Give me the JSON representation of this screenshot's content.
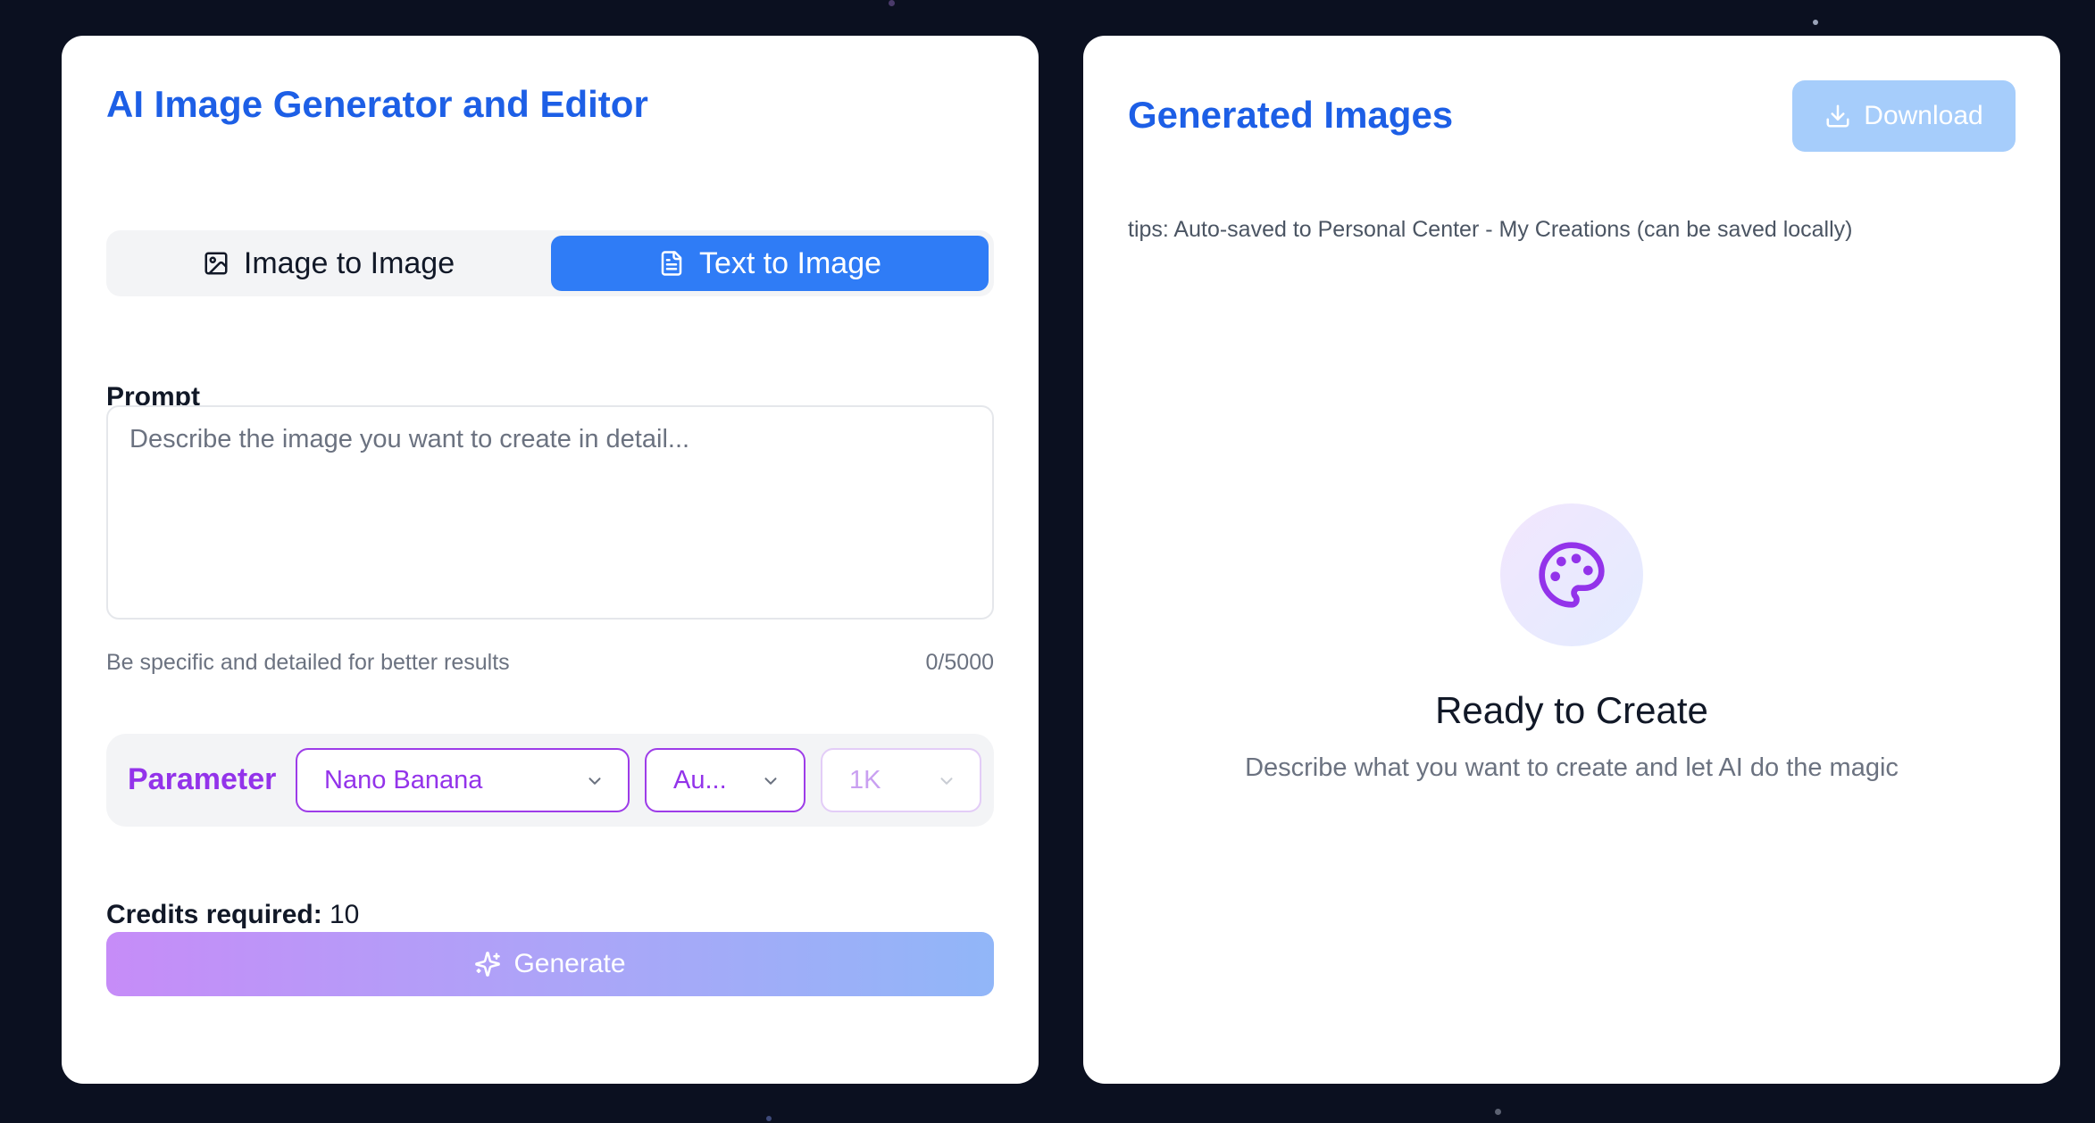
{
  "colors": {
    "background": "#0b1020",
    "accent_blue": "#1d5fe6",
    "tab_active": "#2f7cf6",
    "accent_purple": "#9333ea",
    "download_disabled": "#a6cdfb"
  },
  "editor": {
    "title": "AI Image Generator and Editor",
    "tabs": [
      {
        "label": "Image to Image",
        "icon": "image-icon",
        "active": false
      },
      {
        "label": "Text to Image",
        "icon": "document-icon",
        "active": true
      }
    ],
    "prompt": {
      "label": "Prompt",
      "value": "",
      "placeholder": "Describe the image you want to create in detail...",
      "hint": "Be specific and detailed for better results",
      "count": "0/5000"
    },
    "parameter": {
      "label": "Parameter",
      "model": "Nano Banana",
      "aspect": "Au...",
      "size": "1K"
    },
    "credits": {
      "label": "Credits required:",
      "value": "10"
    },
    "generate_label": "Generate"
  },
  "results": {
    "title": "Generated Images",
    "download_label": "Download",
    "tips": "tips: Auto-saved to Personal Center - My Creations (can be saved locally)",
    "empty_icon": "palette-icon",
    "empty_title": "Ready to Create",
    "empty_subtitle": "Describe what you want to create and let AI do the magic"
  }
}
